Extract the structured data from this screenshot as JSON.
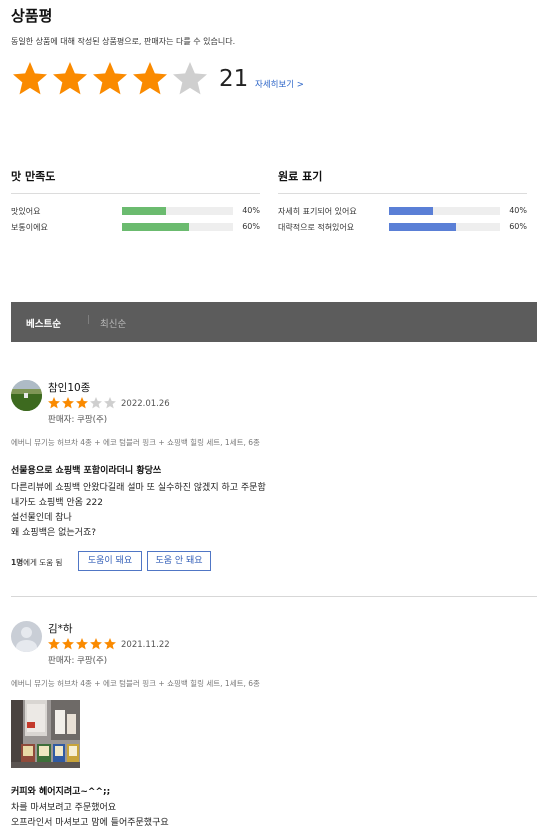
{
  "header": {
    "title": "상품평",
    "description": "동일한 상품에 대해 작성된 상품평으로, 판매자는 다를 수 있습니다.",
    "rating_stars": 4,
    "rating_max": 5,
    "review_count": "21",
    "more_link": "자세히보기 >"
  },
  "colors": {
    "star_on": "#fa8a00",
    "star_off": "#cfcfcf",
    "bar_green": "#6bbb6f",
    "bar_blue": "#5a7fd6",
    "link": "#2e66c8"
  },
  "surveys": [
    {
      "title": "맛 만족도",
      "rows": [
        {
          "label": "맛있어요",
          "percent_label": "40%",
          "value": 0.4
        },
        {
          "label": "보통이에요",
          "percent_label": "60%",
          "value": 0.6
        }
      ]
    },
    {
      "title": "원료 표기",
      "rows": [
        {
          "label": "자세히 표기되어 있어요",
          "percent_label": "40%",
          "value": 0.4
        },
        {
          "label": "대략적으로 적혀있어요",
          "percent_label": "60%",
          "value": 0.6
        }
      ]
    }
  ],
  "sort": {
    "best": "베스트순",
    "separator": "|",
    "newest": "최신순"
  },
  "reviews": [
    {
      "name": "참인10종",
      "stars": 3,
      "date": "2022.01.26",
      "seller": "판매자: 쿠팡(주)",
      "product": "에버니 뮤기능 허브차 4종 + 에코 텀블러 핑크 + 쇼핑백 힐링 세트, 1세트, 6종",
      "headline": "선물용으로 쇼핑백 포함이라더니 황당쓰",
      "body": [
        "다른리뷰에 쇼핑백 안왔다길래 설마 또 실수하진 않겠지 하고 주문함",
        "내가도 쇼핑백 안옴 222",
        "설선물인데 참나",
        "왜 쇼핑백은 없는거죠?"
      ],
      "helpful": {
        "prefix": "1명",
        "suffix": "에게 도움 됨",
        "yes": "도움이 돼요",
        "no": "도움 안 돼요"
      }
    },
    {
      "name": "김*하",
      "stars": 5,
      "date": "2021.11.22",
      "seller": "판매자: 쿠팡(주)",
      "product": "에버니 뮤기능 허브차 4종 + 에코 텀블러 핑크 + 쇼핑백 힐링 세트, 1세트, 6종",
      "headline": "커피와 헤어지려고~^^;;",
      "body": [
        "차를 마셔보려고 주문했어요",
        "오프라인서 마셔보고 맘에 들어주문했구요"
      ]
    }
  ]
}
